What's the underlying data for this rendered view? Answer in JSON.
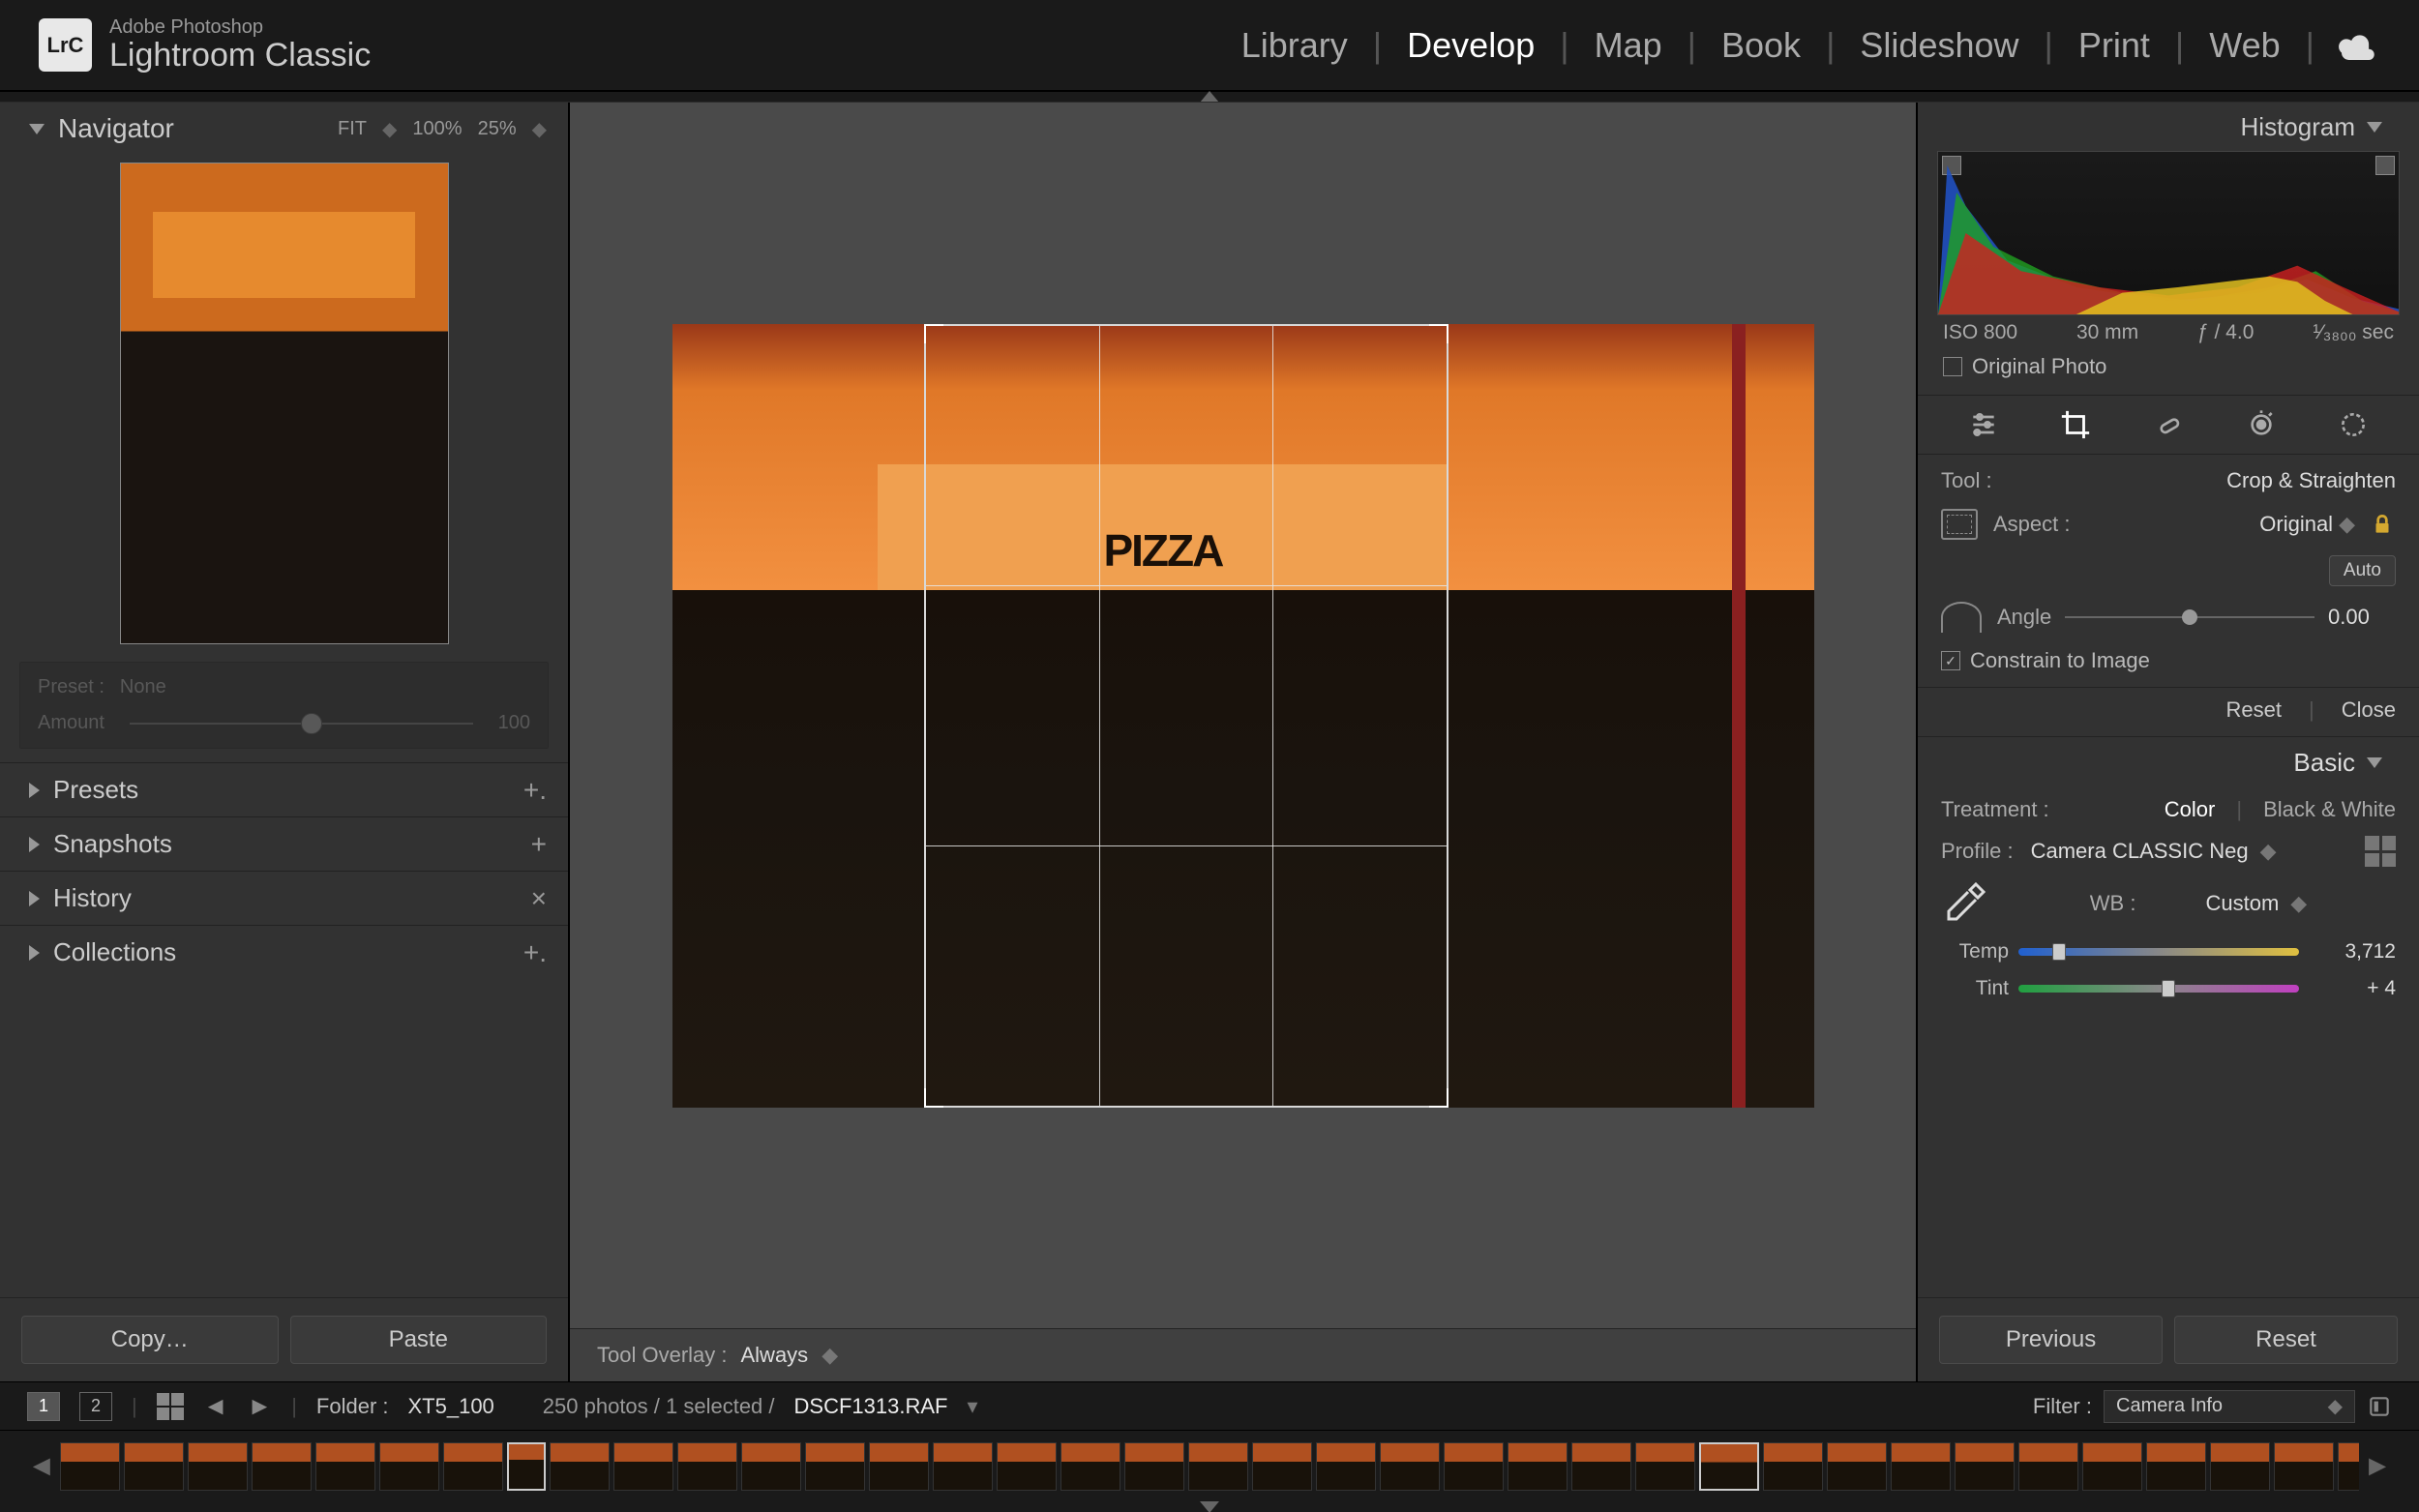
{
  "brand": {
    "product_line": "Adobe Photoshop",
    "product": "Lightroom Classic",
    "logo": "LrC"
  },
  "modules": [
    "Library",
    "Develop",
    "Map",
    "Book",
    "Slideshow",
    "Print",
    "Web"
  ],
  "active_module": "Develop",
  "left": {
    "navigator": {
      "title": "Navigator",
      "zoom": [
        "FIT",
        "100%",
        "25%"
      ]
    },
    "preset_box": {
      "preset_label": "Preset :",
      "preset_value": "None",
      "amount_label": "Amount",
      "amount_value": "100"
    },
    "sections": [
      {
        "title": "Presets",
        "action": "+."
      },
      {
        "title": "Snapshots",
        "action": "+"
      },
      {
        "title": "History",
        "action": "×"
      },
      {
        "title": "Collections",
        "action": "+."
      }
    ],
    "copy": "Copy…",
    "paste": "Paste"
  },
  "center": {
    "overlay_label": "Tool Overlay :",
    "overlay_value": "Always",
    "sign_text": "PIZZA"
  },
  "right": {
    "histogram_title": "Histogram",
    "exif": {
      "iso": "ISO 800",
      "focal": "30 mm",
      "aperture": "ƒ / 4.0",
      "shutter": "¹⁄₃₈₀₀ sec"
    },
    "original_photo": "Original Photo",
    "tool_label": "Tool :",
    "tool_name": "Crop & Straighten",
    "aspect_label": "Aspect :",
    "aspect_value": "Original",
    "auto": "Auto",
    "angle_label": "Angle",
    "angle_value": "0.00",
    "constrain": "Constrain to Image",
    "reset": "Reset",
    "close": "Close",
    "basic_title": "Basic",
    "treatment_label": "Treatment :",
    "treatment_color": "Color",
    "treatment_bw": "Black & White",
    "profile_label": "Profile :",
    "profile_value": "Camera CLASSIC Neg",
    "wb_label": "WB :",
    "wb_value": "Custom",
    "temp_label": "Temp",
    "temp_value": "3,712",
    "tint_label": "Tint",
    "tint_value": "+ 4",
    "previous": "Previous",
    "reset2": "Reset"
  },
  "secbar": {
    "views": [
      "1",
      "2"
    ],
    "folder_label": "Folder :",
    "folder_name": "XT5_100",
    "count": "250 photos / 1 selected /",
    "filename": "DSCF1313.RAF",
    "filter_label": "Filter :",
    "filter_value": "Camera Info"
  },
  "filmstrip": {
    "count": 38,
    "selected_index": 7,
    "highlight_index": 26
  }
}
